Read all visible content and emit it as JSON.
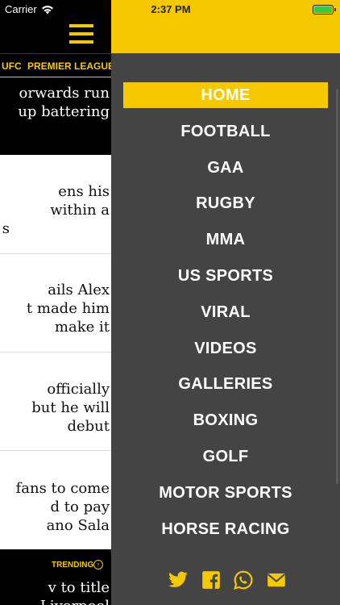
{
  "status_bar": {
    "carrier": "Carrier",
    "time": "2:37 PM",
    "battery_color": "#3cc83c"
  },
  "left_page": {
    "tabs": [
      "UFC",
      "PREMIER LEAGUE"
    ],
    "stories": [
      {
        "lines": [
          "orwards run",
          "up battering"
        ],
        "theme": "dark"
      },
      {
        "lines": [
          "ens his",
          "within a",
          "s"
        ],
        "theme": "light"
      },
      {
        "lines": [
          "ails Alex",
          "t made him",
          "make it"
        ],
        "theme": "light"
      },
      {
        "lines": [
          "officially",
          "but he will",
          "debut"
        ],
        "theme": "light"
      },
      {
        "lines": [
          "fans to come",
          "d to pay",
          "ano Sala"
        ],
        "theme": "light"
      },
      {
        "lines": [
          "v to title",
          "Liverpool"
        ],
        "theme": "dark"
      }
    ],
    "trending_label": "TRENDING"
  },
  "menu": {
    "items": [
      "HOME",
      "FOOTBALL",
      "GAA",
      "RUGBY",
      "MMA",
      "US SPORTS",
      "VIRAL",
      "VIDEOS",
      "GALLERIES",
      "BOXING",
      "GOLF",
      "MOTOR SPORTS",
      "HORSE RACING"
    ],
    "active_item": "HOME",
    "social_icons": [
      "twitter-icon",
      "facebook-icon",
      "whatsapp-icon",
      "email-icon"
    ]
  },
  "colors": {
    "accent": "#f5c800",
    "menu_background": "#444444",
    "page_background": "#000000"
  }
}
